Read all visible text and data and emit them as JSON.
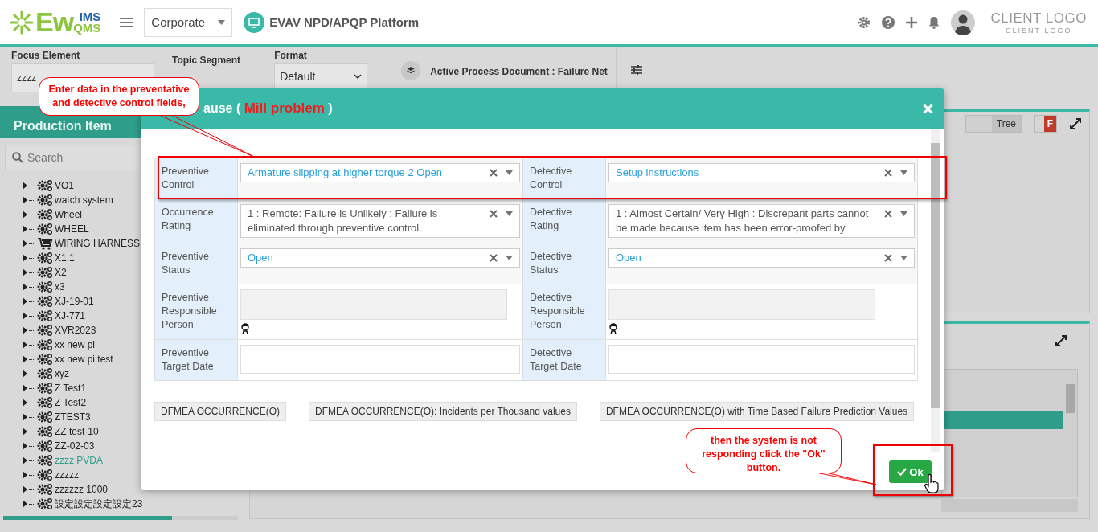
{
  "header": {
    "logo": {
      "main": "Ew",
      "top": "IMS",
      "bottom": "QMS"
    },
    "org_select": "Corporate",
    "platform": "EVAV NPD/APQP Platform",
    "client_logo": "CLIENT LOGO",
    "client_logo_sub": "CLIENT LOGO"
  },
  "toolbar": {
    "focus_element": {
      "label": "Focus Element",
      "value": "zzzz"
    },
    "topic_segment": {
      "label": "Topic Segment"
    },
    "format": {
      "label": "Format",
      "value": "Default"
    },
    "active_document": "Active Process Document : Failure Net"
  },
  "sidebar": {
    "title": "Production Item",
    "search": {
      "placeholder": "Search"
    },
    "tree": [
      {
        "label": "VO1",
        "kind": "gear",
        "selected": false
      },
      {
        "label": "watch system",
        "kind": "gear",
        "selected": false
      },
      {
        "label": "Wheel",
        "kind": "gear",
        "selected": false
      },
      {
        "label": "WHEEL",
        "kind": "gear",
        "selected": false
      },
      {
        "label": "WIRING HARNESS",
        "kind": "cart",
        "selected": false
      },
      {
        "label": "X1.1",
        "kind": "gear",
        "selected": false
      },
      {
        "label": "X2",
        "kind": "gear",
        "selected": false
      },
      {
        "label": "x3",
        "kind": "gear",
        "selected": false
      },
      {
        "label": "XJ-19-01",
        "kind": "gear",
        "selected": false
      },
      {
        "label": "XJ-771",
        "kind": "gear",
        "selected": false
      },
      {
        "label": "XVR2023",
        "kind": "gear",
        "selected": false
      },
      {
        "label": "xx new pi",
        "kind": "gear",
        "selected": false
      },
      {
        "label": "xx new pi test",
        "kind": "gear",
        "selected": false
      },
      {
        "label": "xyz",
        "kind": "gear",
        "selected": false
      },
      {
        "label": "Z Test1",
        "kind": "gear",
        "selected": false
      },
      {
        "label": "Z Test2",
        "kind": "gear",
        "selected": false
      },
      {
        "label": "ZTEST3",
        "kind": "gear",
        "selected": false
      },
      {
        "label": "ZZ test-10",
        "kind": "gear",
        "selected": false
      },
      {
        "label": "ZZ-02-03",
        "kind": "gear",
        "selected": false
      },
      {
        "label": "zzzz PVDA",
        "kind": "gear",
        "selected": true
      },
      {
        "label": "zzzzz",
        "kind": "gear",
        "selected": false
      },
      {
        "label": "zzzzzz 1000",
        "kind": "gear",
        "selected": false
      },
      {
        "label": "設定設定設定設定23",
        "kind": "gear",
        "selected": false
      }
    ]
  },
  "view": {
    "tree_toggle": "Tree",
    "f_button": "F"
  },
  "modal": {
    "title_start": "ause (",
    "title_highlight": "Mill problem",
    "title_end": ")",
    "rows": [
      {
        "preventive": {
          "label": "Preventive Control",
          "kind": "select",
          "value": "Armature slipping at higher torque 2 Open"
        },
        "detective": {
          "label": "Detective Control",
          "kind": "select",
          "value": "Setup instructions"
        }
      },
      {
        "preventive": {
          "label": "Occurrence Rating",
          "kind": "rating",
          "value": "1 : Remote: Failure is Unlikely : Failure is eliminated through preventive control."
        },
        "detective": {
          "label": "Detective Rating",
          "kind": "rating",
          "value": "1 : Almost Certain/ Very High : Discrepant parts cannot be made because item has been error-proofed by"
        }
      },
      {
        "preventive": {
          "label": "Preventive Status",
          "kind": "select",
          "value": "Open"
        },
        "detective": {
          "label": "Detective Status",
          "kind": "select",
          "value": "Open"
        }
      },
      {
        "preventive": {
          "label": "Preventive Responsible Person",
          "kind": "person"
        },
        "detective": {
          "label": "Detective Responsible Person",
          "kind": "person"
        }
      },
      {
        "preventive": {
          "label": "Preventive Target Date",
          "kind": "date"
        },
        "detective": {
          "label": "Detective Target Date",
          "kind": "date"
        }
      }
    ],
    "scale_buttons": [
      "DFMEA OCCURRENCE(O)",
      "DFMEA OCCURRENCE(O): Incidents per Thousand values",
      "DFMEA OCCURRENCE(O) with Time Based Failure Prediction Values"
    ],
    "ok_button": "Ok"
  },
  "callouts": [
    "Enter data in the preventative and detective control fields,",
    "then the system is not responding click the \"Ok\" button."
  ]
}
